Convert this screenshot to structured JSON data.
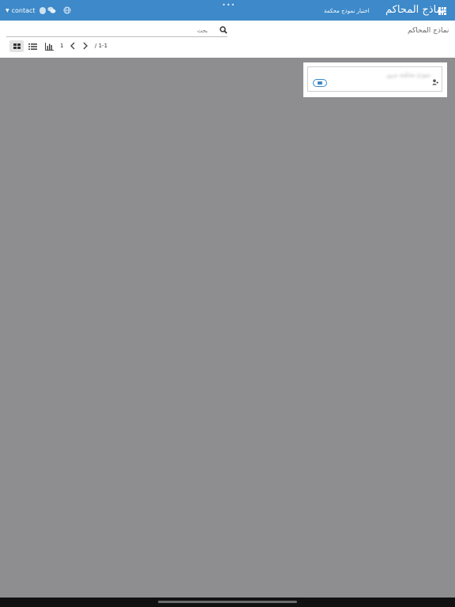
{
  "navbar": {
    "title": "نماذج المحاكم",
    "link": "اختيار نموذج محكمة",
    "contact_label": "contact",
    "background": "#3d89c9"
  },
  "toolbar": {
    "breadcrumb": "نماذج المحاكم",
    "search_placeholder": "بحث",
    "page_number": "1",
    "range": "/ 1-1"
  },
  "card": {
    "title": "نموذج محكمة مرور"
  }
}
